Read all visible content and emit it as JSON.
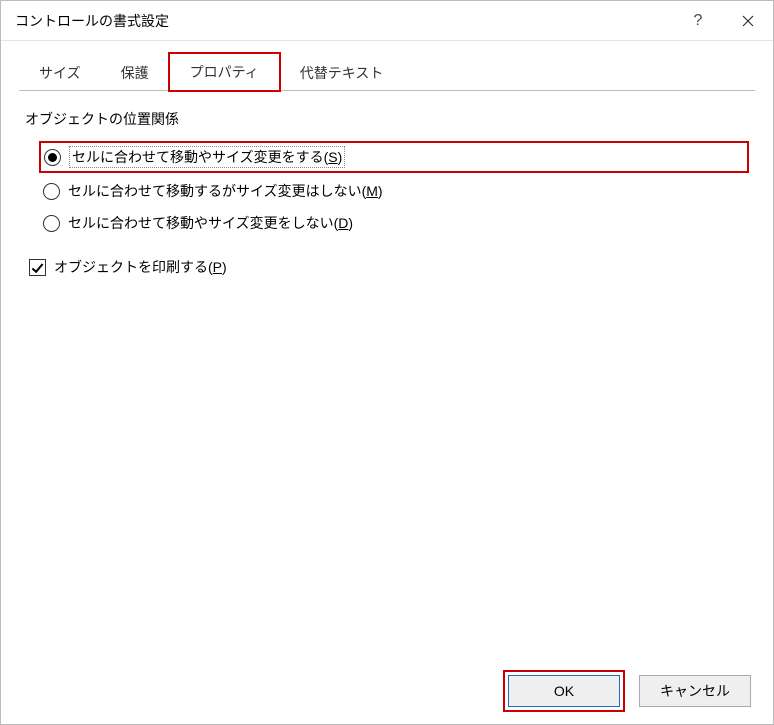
{
  "titlebar": {
    "title": "コントロールの書式設定"
  },
  "tabs": {
    "size": "サイズ",
    "protect": "保護",
    "properties": "プロパティ",
    "alttext": "代替テキスト"
  },
  "group": {
    "label": "オブジェクトの位置関係"
  },
  "radio": {
    "opt1_pre": "セルに合わせて移動やサイズ変更をする(",
    "opt1_m": "S",
    "opt1_post": ")",
    "opt2_pre": "セルに合わせて移動するがサイズ変更はしない(",
    "opt2_m": "M",
    "opt2_post": ")",
    "opt3_pre": "セルに合わせて移動やサイズ変更をしない(",
    "opt3_m": "D",
    "opt3_post": ")"
  },
  "check": {
    "print_pre": "オブジェクトを印刷する(",
    "print_m": "P",
    "print_post": ")"
  },
  "footer": {
    "ok": "OK",
    "cancel": "キャンセル"
  }
}
